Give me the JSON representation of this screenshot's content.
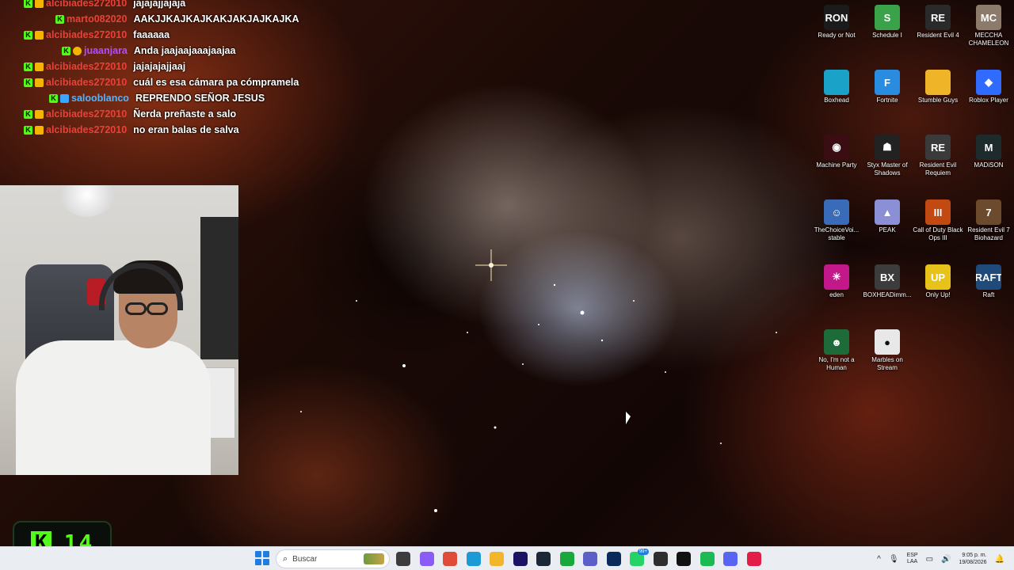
{
  "chat": {
    "messages": [
      {
        "user": "alcibiades272010",
        "user_color": "#e8413a",
        "text": "jajajajjajaja",
        "badges": [
          "kick",
          "crown"
        ],
        "indent": 0
      },
      {
        "user": "marto082020",
        "user_color": "#e8413a",
        "text": "AAKJJKAJKAJKAKJAKJAJKAJKA",
        "badges": [
          "kick"
        ],
        "indent": 40
      },
      {
        "user": "alcibiades272010",
        "user_color": "#e8413a",
        "text": "faaaaaa",
        "badges": [
          "kick",
          "crown"
        ],
        "indent": 0
      },
      {
        "user": "juaanjara",
        "user_color": "#b64cff",
        "text": "Anda jaajaajaaajaajaa",
        "badges": [
          "kick",
          "coin"
        ],
        "indent": 48
      },
      {
        "user": "alcibiades272010",
        "user_color": "#e8413a",
        "text": "jajajajajjaaj",
        "badges": [
          "kick",
          "crown"
        ],
        "indent": 0
      },
      {
        "user": "alcibiades272010",
        "user_color": "#e8413a",
        "text": "cuál es esa cámara pa cómpramela",
        "badges": [
          "kick",
          "crown"
        ],
        "indent": 0
      },
      {
        "user": "salooblanco",
        "user_color": "#4fb4ff",
        "text": "REPRENDO SEÑOR JESUS",
        "badges": [
          "kick",
          "blue"
        ],
        "indent": 32
      },
      {
        "user": "alcibiades272010",
        "user_color": "#e8413a",
        "text": "Ñerda preñaste a salo",
        "badges": [
          "kick",
          "crown"
        ],
        "indent": 0
      },
      {
        "user": "alcibiades272010",
        "user_color": "#e8413a",
        "text": "no eran balas de salva",
        "badges": [
          "kick",
          "crown"
        ],
        "indent": 0
      }
    ]
  },
  "kick_counter": {
    "logo": "K",
    "count": "14",
    "accent": "#53fc18"
  },
  "desktop_icons": [
    {
      "label": "Ready or Not",
      "color": "#1b1b1b",
      "glyph": "RON"
    },
    {
      "label": "Schedule I",
      "color": "#3aa34a",
      "glyph": "S"
    },
    {
      "label": "Resident Evil 4",
      "color": "#2a2a2a",
      "glyph": "RE"
    },
    {
      "label": "MECCHA CHAMELEON",
      "color": "#8c7a6b",
      "glyph": "MC"
    },
    {
      "label": "Boxhead",
      "color": "#1aa2c9",
      "glyph": ""
    },
    {
      "label": "Fortnite",
      "color": "#2a8ce0",
      "glyph": "F"
    },
    {
      "label": "Stumble Guys",
      "color": "#f0b429",
      "glyph": ""
    },
    {
      "label": "Roblox Player",
      "color": "#2f6bff",
      "glyph": "◆"
    },
    {
      "label": "Machine Party",
      "color": "#3a0d12",
      "glyph": "◉"
    },
    {
      "label": "Styx Master of Shadows",
      "color": "#222222",
      "glyph": "☗"
    },
    {
      "label": "Resident Evil Requiem",
      "color": "#3a3a3a",
      "glyph": "RE"
    },
    {
      "label": "MADiSON",
      "color": "#1d2b2c",
      "glyph": "M"
    },
    {
      "label": "TheChoiceVoi... stable",
      "color": "#3a6bb8",
      "glyph": "☺"
    },
    {
      "label": "PEAK",
      "color": "#8a8fd6",
      "glyph": "▲"
    },
    {
      "label": "Call of Duty Black Ops III",
      "color": "#c24a12",
      "glyph": "III"
    },
    {
      "label": "Resident Evil 7 Biohazard",
      "color": "#6b4a2e",
      "glyph": "7"
    },
    {
      "label": "eden",
      "color": "#c2188a",
      "glyph": "☀"
    },
    {
      "label": "BOXHEADimm...",
      "color": "#3c3c3c",
      "glyph": "BX"
    },
    {
      "label": "Only Up!",
      "color": "#e6c21a",
      "glyph": "UP"
    },
    {
      "label": "Raft",
      "color": "#1f4a7a",
      "glyph": "RAFT"
    },
    {
      "label": "No, I'm not a Human",
      "color": "#1e6b3a",
      "glyph": "☻"
    },
    {
      "label": "Marbles on Stream",
      "color": "#e8e8e8",
      "glyph": "●"
    }
  ],
  "taskbar": {
    "search_placeholder": "Buscar",
    "search_icon": "search-icon",
    "start_icon": "windows-start-icon",
    "apps": [
      {
        "name": "task-view-icon",
        "color": "#3c3c3c"
      },
      {
        "name": "copilot-icon",
        "color": "#8a5cf5"
      },
      {
        "name": "chrome-icon",
        "color": "#e04b3a"
      },
      {
        "name": "edge-icon",
        "color": "#1c9ad6"
      },
      {
        "name": "file-explorer-icon",
        "color": "#f2b62a"
      },
      {
        "name": "premiere-pro-icon",
        "color": "#1b1464"
      },
      {
        "name": "steam-icon",
        "color": "#1b2838"
      },
      {
        "name": "gamepass-icon",
        "color": "#19a83b"
      },
      {
        "name": "teams-icon",
        "color": "#5b5fc7"
      },
      {
        "name": "audition-icon",
        "color": "#0a2a5a"
      },
      {
        "name": "whatsapp-icon",
        "color": "#25d366",
        "badge": "99+"
      },
      {
        "name": "obs-icon",
        "color": "#2e2e2e"
      },
      {
        "name": "roblox-app-icon",
        "color": "#111111"
      },
      {
        "name": "spotify-icon",
        "color": "#1db954"
      },
      {
        "name": "discord-icon",
        "color": "#5865f2"
      },
      {
        "name": "tiktok-icon",
        "color": "#e11d48"
      }
    ],
    "tray": {
      "chevron": "^",
      "lang_top": "ESP",
      "lang_bottom": "LAA",
      "time": "9:05 p. m.",
      "date": "19/08/2026"
    }
  }
}
